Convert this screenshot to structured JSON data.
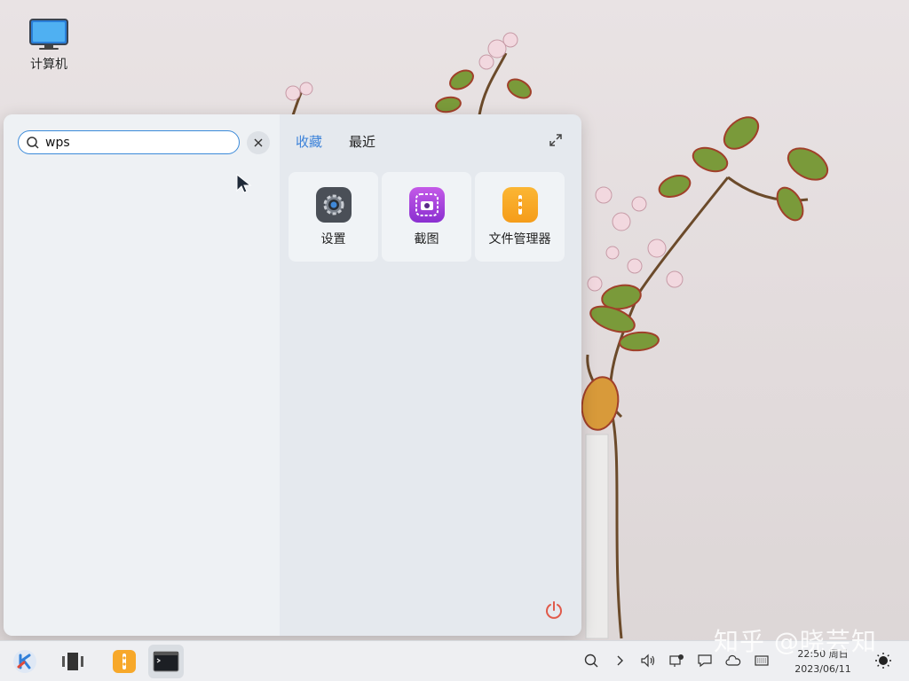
{
  "desktop": {
    "icons": [
      {
        "label": "计算机",
        "icon": "computer-icon"
      }
    ]
  },
  "start_menu": {
    "search": {
      "value": "wps",
      "placeholder": ""
    },
    "tabs": [
      {
        "label": "收藏",
        "active": true
      },
      {
        "label": "最近",
        "active": false
      }
    ],
    "favorites": [
      {
        "label": "设置",
        "icon": "settings-gear-icon",
        "color": "#4a4f57"
      },
      {
        "label": "截图",
        "icon": "screenshot-camera-icon",
        "color": "#a03ed8"
      },
      {
        "label": "文件管理器",
        "icon": "file-manager-icon",
        "color": "#f6a623"
      }
    ]
  },
  "taskbar": {
    "items": [
      {
        "name": "start-menu",
        "icon": "kylin-logo-icon"
      },
      {
        "name": "multitask-view",
        "icon": "multitask-view-icon"
      },
      {
        "name": "file-manager",
        "icon": "file-manager-icon"
      },
      {
        "name": "terminal",
        "icon": "terminal-icon",
        "active": true
      }
    ],
    "tray": [
      "search-icon",
      "chevron-right-icon",
      "volume-icon",
      "network-icon",
      "notification-icon",
      "weather-cloud-icon",
      "keyboard-icon"
    ],
    "clock": {
      "time": "22:50 周日",
      "date": "2023/06/11"
    }
  },
  "watermark": "知乎 @晓芸知",
  "colors": {
    "accent": "#3b82d9",
    "power": "#e05a4a"
  }
}
